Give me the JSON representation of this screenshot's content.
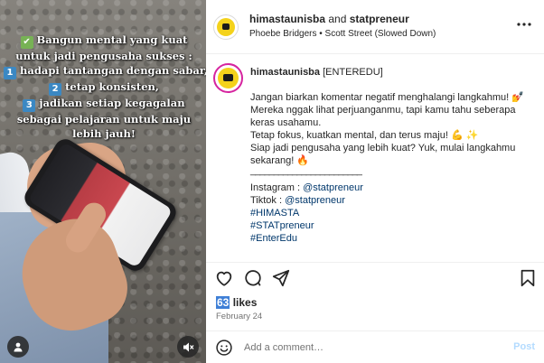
{
  "media": {
    "overlay_lines": [
      {
        "prefix": "✔",
        "text": "Bangun mental yang kuat"
      },
      {
        "prefix": "",
        "text": "untuk jadi pengusaha sukses :"
      },
      {
        "prefix": "1",
        "text": "hadapi tantangan dengan sabar,"
      },
      {
        "prefix": "2",
        "text": "tetap konsisten,"
      },
      {
        "prefix": "3",
        "text": "jadikan setiap kegagalan"
      },
      {
        "prefix": "",
        "text": "sebagai pelajaran untuk maju"
      },
      {
        "prefix": "",
        "text": "lebih jauh!"
      }
    ],
    "user_tag_icon": "person-icon",
    "mute_icon": "speaker-muted-icon"
  },
  "header": {
    "account1": "himastaunisba",
    "connector": "and",
    "account2": "statpreneur",
    "audio": "Phoebe Bridgers • Scott Street (Slowed Down)"
  },
  "caption": {
    "username": "himastaunisba",
    "tag": "[ENTEREDU]",
    "para1": "Jangan biarkan komentar negatif menghalangi langkahmu! 💅",
    "para2": "Mereka nggak lihat perjuanganmu, tapi kamu tahu seberapa keras usahamu.",
    "para3": "Tetap fokus, kuatkan mental, dan terus maju! 💪 ✨",
    "para4": "Siap jadi pengusaha yang lebih kuat? Yuk, mulai langkahmu sekarang! 🔥",
    "rule": "________________________",
    "instagram_label": "Instagram : ",
    "instagram_handle": "@statpreneur",
    "tiktok_label": "Tiktok : ",
    "tiktok_handle": "@statpreneur",
    "hashtags": [
      "#HIMASTA",
      "#STATpreneur",
      "#EnterEdu"
    ]
  },
  "engagement": {
    "likes_count": "63",
    "likes_label": " likes",
    "date": "February 24"
  },
  "comment": {
    "placeholder": "Add a comment…",
    "post_label": "Post"
  },
  "colors": {
    "link": "#00376b",
    "post_disabled": "#b3dbff",
    "avatar_yellow": "#f4d21b",
    "story_ring": "#d6249f"
  }
}
